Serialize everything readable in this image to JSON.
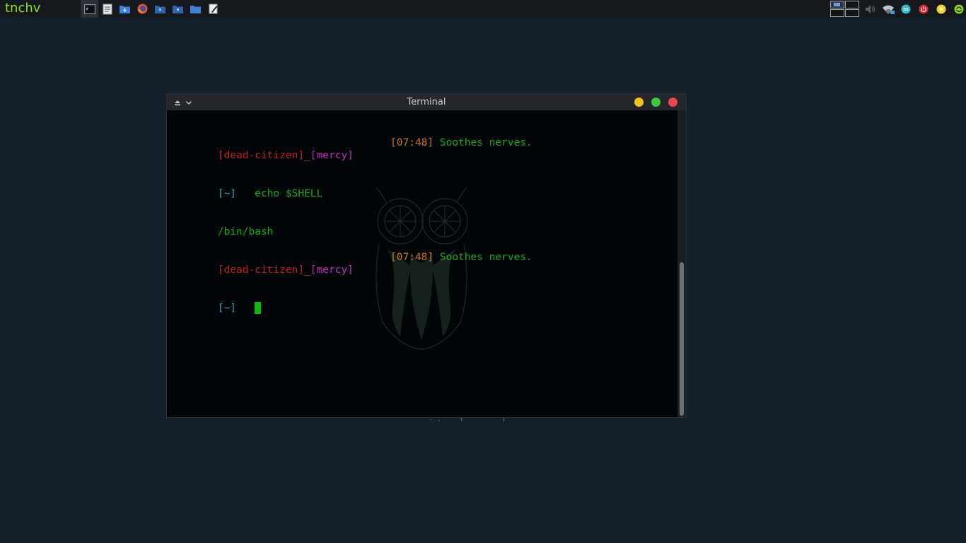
{
  "panel": {
    "brand": "tnchv",
    "launchers": [
      {
        "icon": "terminal-icon",
        "active": true
      },
      {
        "icon": "text-editor-icon",
        "active": false
      },
      {
        "icon": "downloads-folder-icon",
        "active": false
      },
      {
        "icon": "firefox-icon",
        "active": false
      },
      {
        "icon": "folder-dark-icon",
        "active": false
      },
      {
        "icon": "folder-dark-2-icon",
        "active": false
      },
      {
        "icon": "folder-blue-icon",
        "active": false
      },
      {
        "icon": "notes-pen-icon",
        "active": false
      }
    ],
    "workspaces": 4,
    "current_workspace": 1,
    "tray": [
      "volume-icon",
      "wifi-icon",
      "chat-icon",
      "power-icon",
      "sun-icon",
      "update-icon"
    ]
  },
  "window": {
    "title": "Terminal",
    "eject_glyph": "⏏",
    "chevron_glyph": "⌄"
  },
  "terminal": {
    "line1": {
      "user": "[dead-citizen]",
      "sep": "_",
      "host": "[mercy]",
      "time": "[07:48]",
      "msg": "Soothes nerves."
    },
    "line2": {
      "dir": "[~]",
      "cmd": "   echo $SHELL"
    },
    "line3": {
      "output": "/bin/bash"
    },
    "line4": {
      "user": "[dead-citizen]",
      "sep": "_",
      "host": "[mercy]",
      "time": "[07:48]",
      "msg": "Soothes nerves."
    },
    "line5": {
      "dir": "[~]",
      "cmd": "   "
    }
  },
  "colors": {
    "desktop": "#13202b",
    "panel": "#15191d",
    "brand": "#8fe01a",
    "user": "#c02020",
    "host": "#c12cc1",
    "time": "#d1731c",
    "message": "#19a71b",
    "dir": "#27a7b3",
    "cursor": "#0fb80f"
  }
}
